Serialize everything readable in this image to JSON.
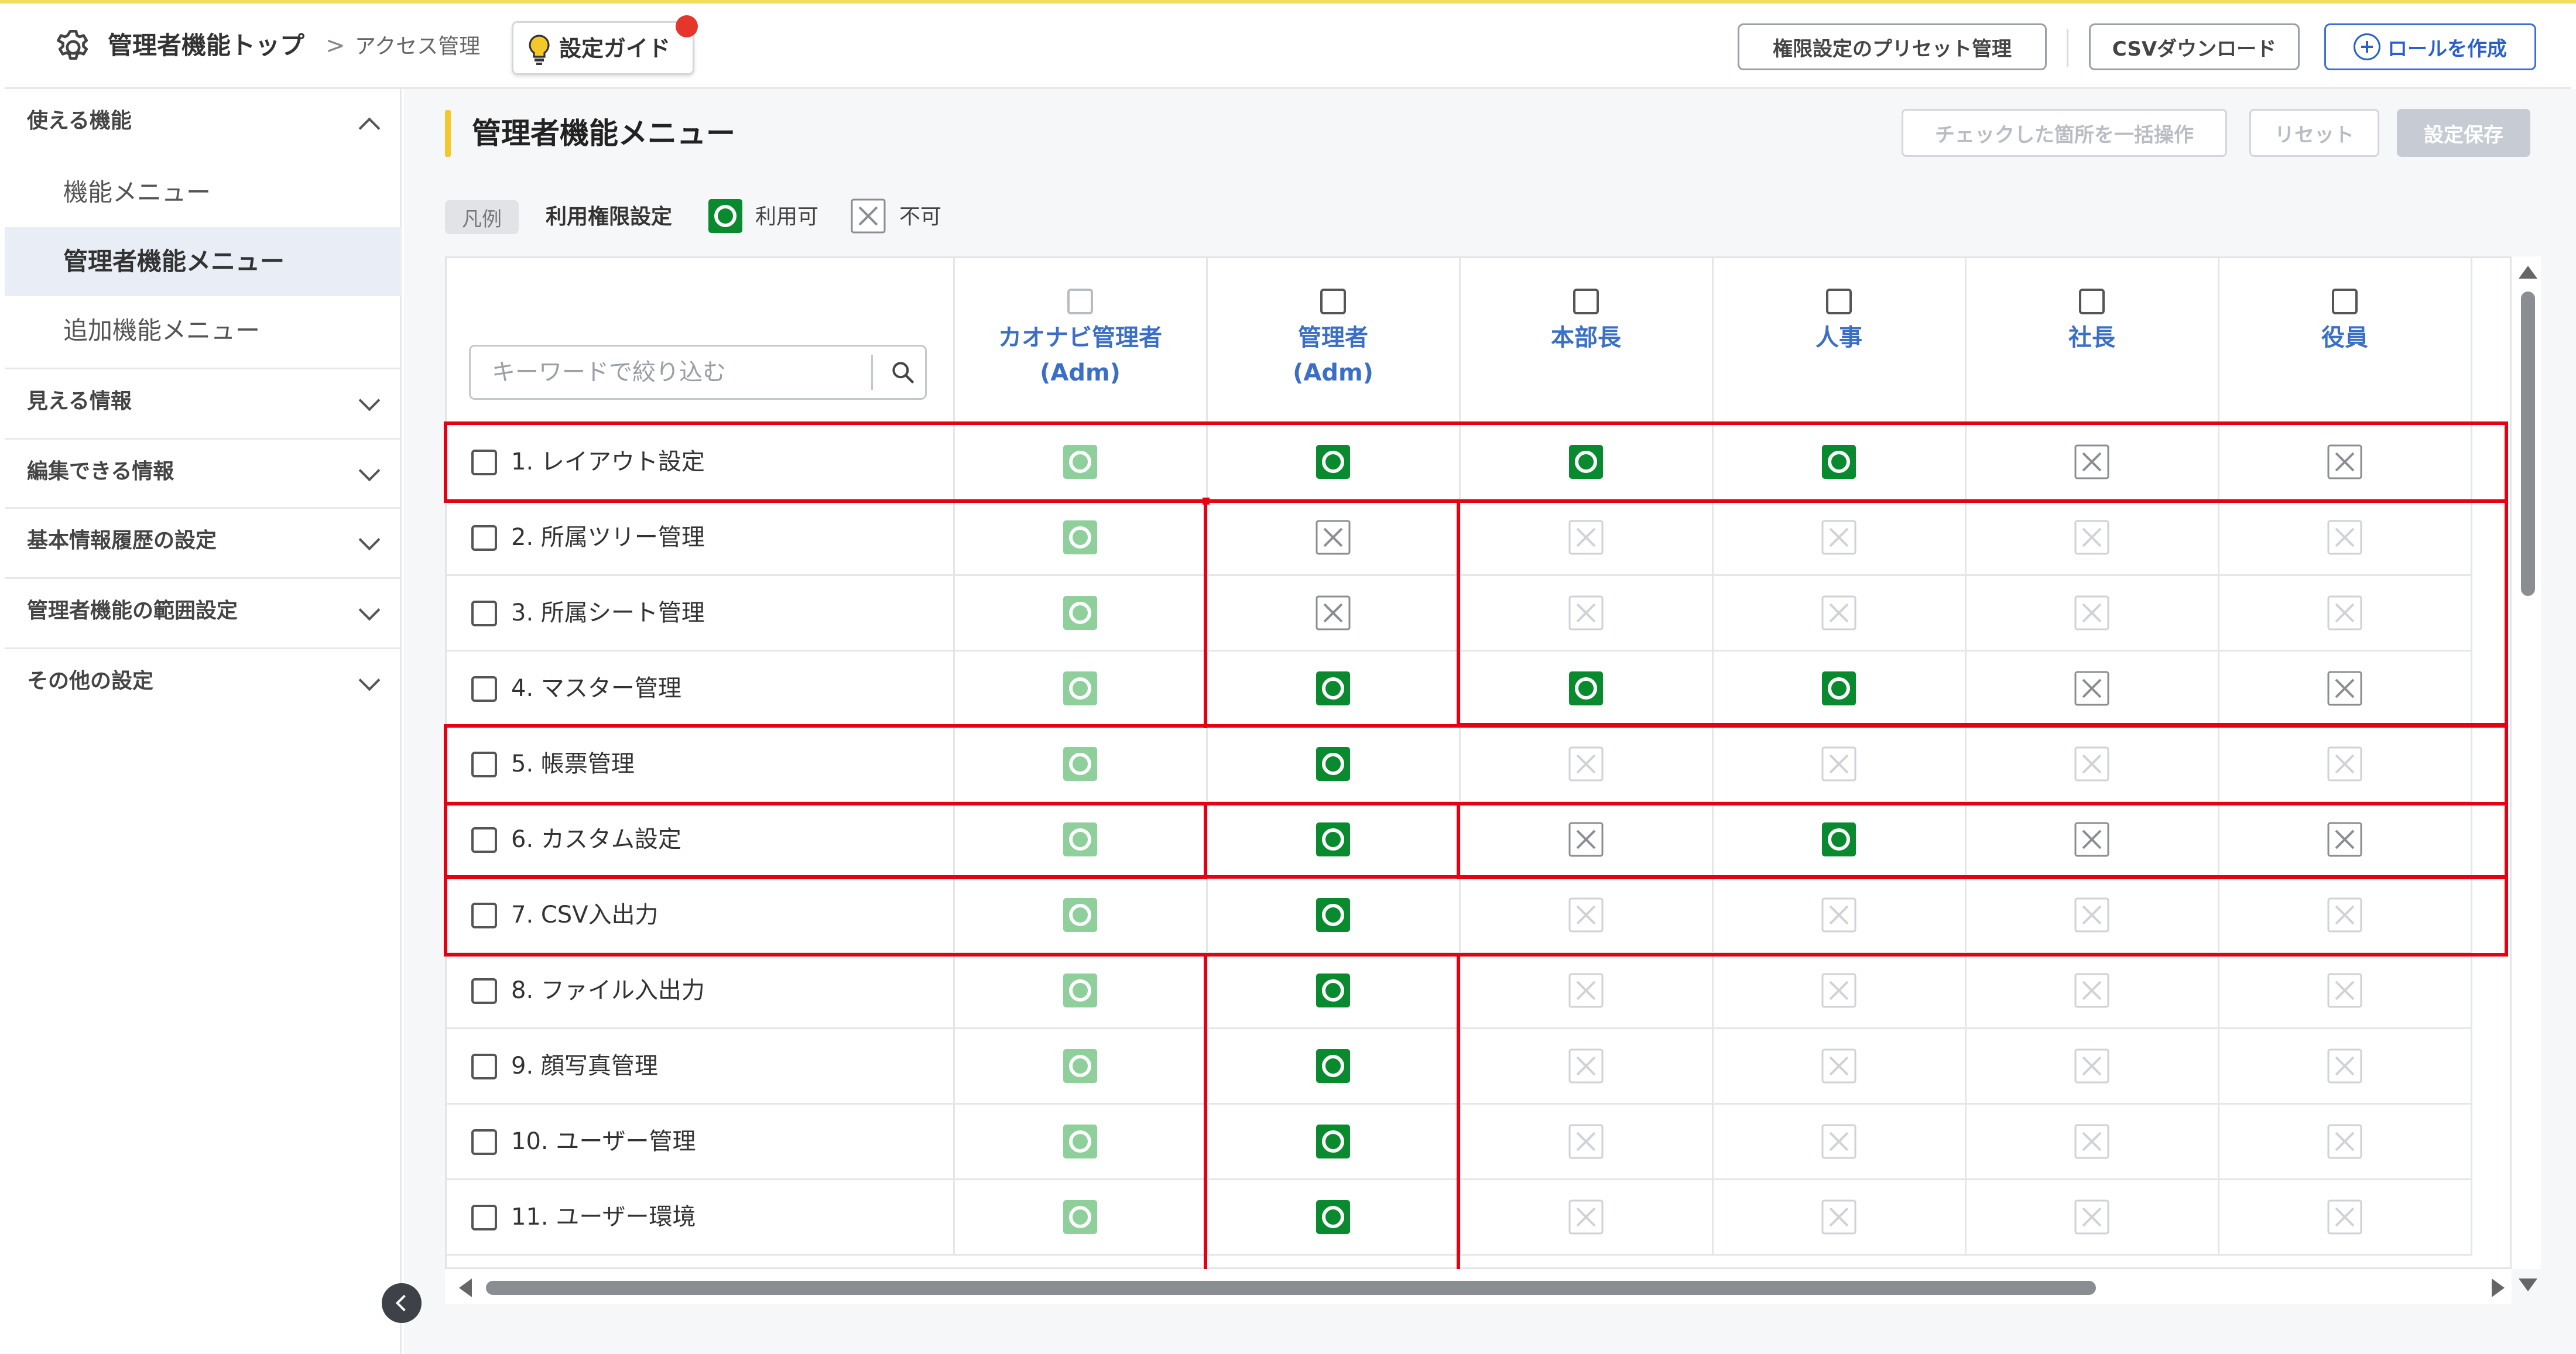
{
  "header": {
    "home_label": "管理者機能トップ",
    "separator": ">",
    "current_label": "アクセス管理",
    "guide_label": "設定ガイド",
    "preset_label": "権限設定のプリセット管理",
    "csv_label": "CSVダウンロード",
    "role_label": "ロールを作成"
  },
  "sidebar": {
    "sections": [
      {
        "label": "使える機能",
        "expanded": true
      },
      {
        "label": "見える情報",
        "expanded": false
      },
      {
        "label": "編集できる情報",
        "expanded": false
      },
      {
        "label": "基本情報履歴の設定",
        "expanded": false
      },
      {
        "label": "管理者機能の範囲設定",
        "expanded": false
      },
      {
        "label": "その他の設定",
        "expanded": false
      }
    ],
    "items": [
      {
        "label": "機能メニュー"
      },
      {
        "label": "管理者機能メニュー",
        "active": true
      },
      {
        "label": "追加機能メニュー"
      }
    ]
  },
  "main": {
    "title": "管理者機能メニュー",
    "bulk_label": "チェックした箇所を一括操作",
    "reset_label": "リセット",
    "save_label": "設定保存",
    "legend": {
      "tag": "凡例",
      "label": "利用権限設定",
      "allowed": "利用可",
      "denied": "不可"
    },
    "search_placeholder": "キーワードで絞り込む",
    "roles": [
      {
        "line1": "カオナビ管理者",
        "line2": "(Adm)"
      },
      {
        "line1": "管理者",
        "line2": "(Adm)"
      },
      {
        "line1": "本部長",
        "line2": ""
      },
      {
        "line1": "人事",
        "line2": ""
      },
      {
        "line1": "社長",
        "line2": ""
      },
      {
        "line1": "役員",
        "line2": ""
      }
    ],
    "rows": [
      {
        "label": "1. レイアウト設定",
        "marks": [
          "ok-light",
          "ok",
          "ok",
          "ok",
          "ng",
          "ng"
        ]
      },
      {
        "label": "2. 所属ツリー管理",
        "marks": [
          "ok-light",
          "ng",
          "ng-light",
          "ng-light",
          "ng-light",
          "ng-light"
        ]
      },
      {
        "label": "3. 所属シート管理",
        "marks": [
          "ok-light",
          "ng",
          "ng-light",
          "ng-light",
          "ng-light",
          "ng-light"
        ]
      },
      {
        "label": "4. マスター管理",
        "marks": [
          "ok-light",
          "ok",
          "ok",
          "ok",
          "ng",
          "ng"
        ]
      },
      {
        "label": "5. 帳票管理",
        "marks": [
          "ok-light",
          "ok",
          "ng-light",
          "ng-light",
          "ng-light",
          "ng-light"
        ]
      },
      {
        "label": "6. カスタム設定",
        "marks": [
          "ok-light",
          "ok",
          "ng",
          "ok",
          "ng",
          "ng"
        ]
      },
      {
        "label": "7. CSV入出力",
        "marks": [
          "ok-light",
          "ok",
          "ng-light",
          "ng-light",
          "ng-light",
          "ng-light"
        ]
      },
      {
        "label": "8. ファイル入出力",
        "marks": [
          "ok-light",
          "ok",
          "ng-light",
          "ng-light",
          "ng-light",
          "ng-light"
        ]
      },
      {
        "label": "9. 顔写真管理",
        "marks": [
          "ok-light",
          "ok",
          "ng-light",
          "ng-light",
          "ng-light",
          "ng-light"
        ]
      },
      {
        "label": "10. ユーザー管理",
        "marks": [
          "ok-light",
          "ok",
          "ng-light",
          "ng-light",
          "ng-light",
          "ng-light"
        ]
      },
      {
        "label": "11. ユーザー環境",
        "marks": [
          "ok-light",
          "ok",
          "ng-light",
          "ng-light",
          "ng-light",
          "ng-light"
        ]
      }
    ]
  },
  "colors": {
    "accent_yellow": "#f4c82a",
    "allowed_green": "#0a8a2e",
    "allowed_green_light": "#8fcf9c",
    "denied_gray": "#8a8d92",
    "denied_gray_light": "#cfd2d6",
    "highlight_red": "#e60012",
    "link_blue": "#3b6fc5"
  }
}
